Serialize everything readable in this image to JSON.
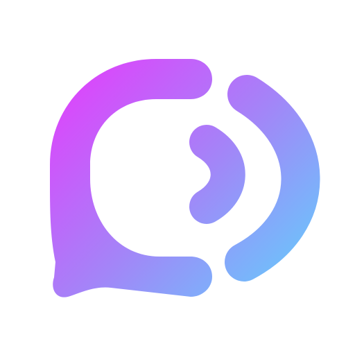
{
  "logo": {
    "icon": "chat-bubble-signal-icon",
    "colors": {
      "gradient_start": "#e23ffc",
      "gradient_mid": "#a385f8",
      "gradient_end": "#6ac6fb",
      "background": "#ffffff"
    }
  }
}
